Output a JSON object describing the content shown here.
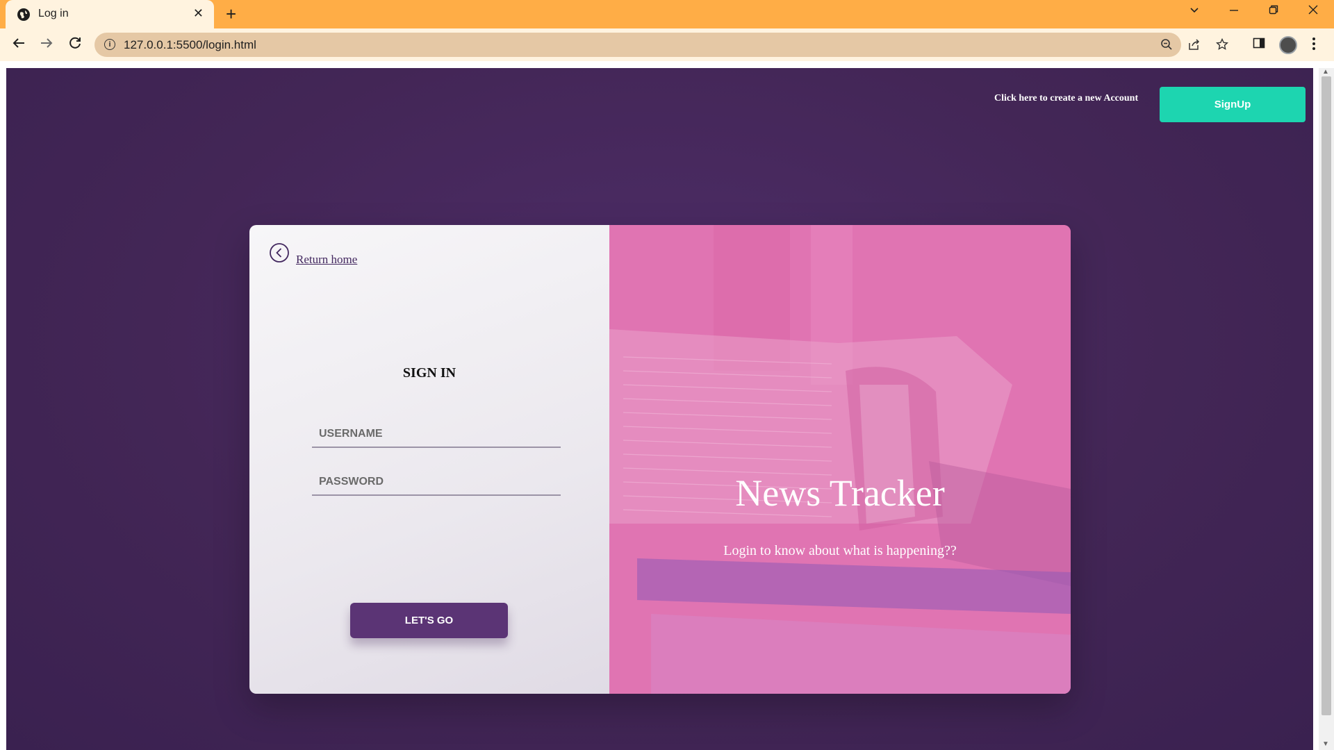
{
  "browser": {
    "tab_title": "Log in",
    "tab_close": "✕",
    "new_tab": "+",
    "url": "127.0.0.1:5500/login.html",
    "tabbar_color": "#ffad46",
    "toolbar_color": "#fff3df"
  },
  "page": {
    "signup_hint": "Click here to create a new Account",
    "signup_button": "SignUp",
    "return_home": "Return home",
    "signin_title": "SIGN IN",
    "username_placeholder": "USERNAME",
    "password_placeholder": "PASSWORD",
    "submit_button": "LET'S GO",
    "hero_title": "News Tracker",
    "hero_subtitle": "Login to know about what is happening??",
    "colors": {
      "background": "#432656",
      "signup_button": "#1dd5b0",
      "submit_button": "#5b3475",
      "hero_panel": "#e06ba8"
    }
  }
}
